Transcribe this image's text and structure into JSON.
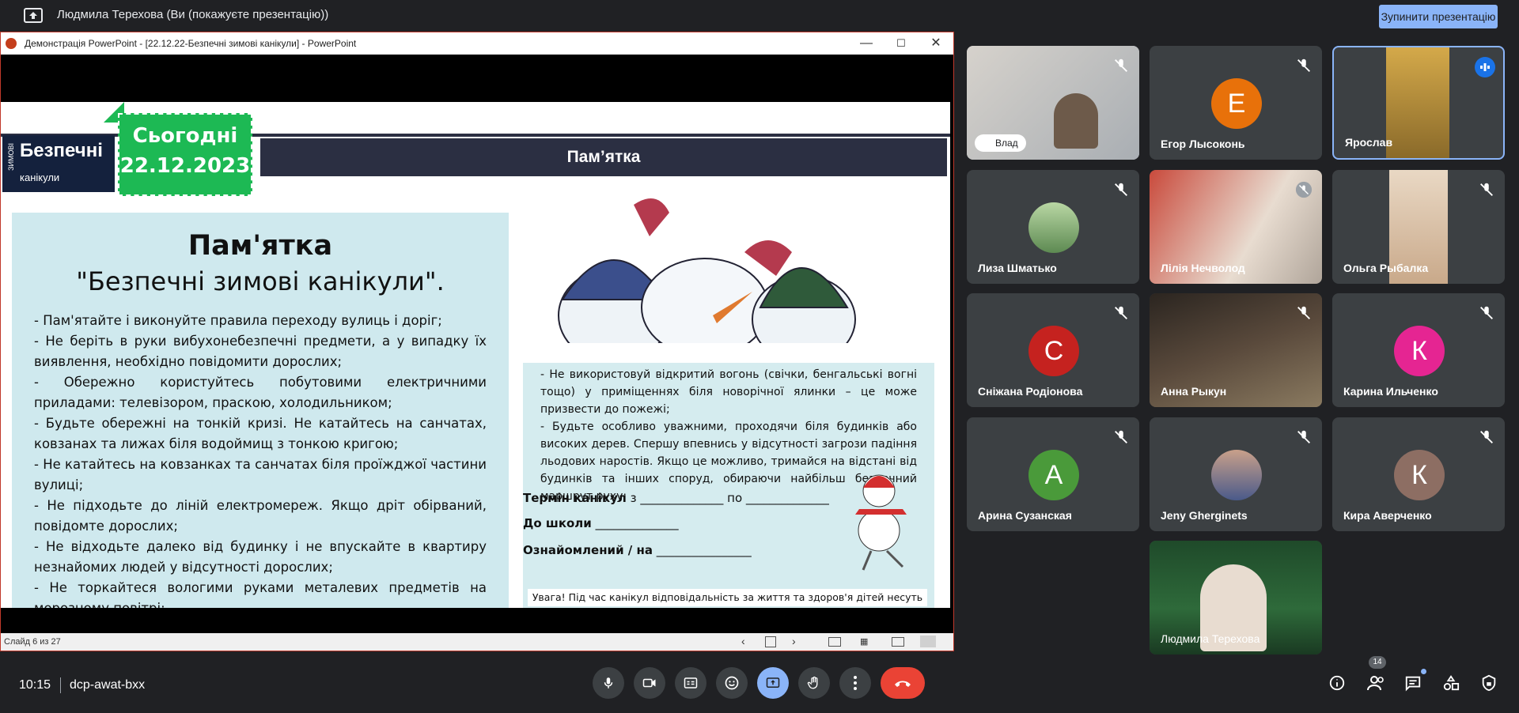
{
  "topbar": {
    "presenter_text": "Людмила Терехова (Ви (покажуєте презентацію))",
    "stop_button": "Зупинити презентацію"
  },
  "ppt": {
    "window_title": "Демонстрація PowerPoint - [22.12.22-Безпечні зимові канікули] - PowerPoint",
    "status_slide": "Слайд 6 из 27"
  },
  "slide": {
    "logo_small": "ЗИМОВІ",
    "logo_big": "Безпечні",
    "logo_sub": "канікули",
    "date_line1": "Сьогодні",
    "date_line2": "22.12.2023",
    "header": "Пам’ятка",
    "left_title": "Пам'ятка",
    "left_subtitle": "\"Безпечні зимові канікули\".",
    "left_items": [
      "- Пам'ятайте і виконуйте правила переходу вулиць і доріг;",
      "- Не беріть в руки вибухонебезпечні предмети, а у випадку їх виявлення, необхідно повідомити дорослих;",
      "- Обережно користуйтесь побутовими електричними приладами: телевізором, праскою, холодильником;",
      "- Будьте обережні на тонкій кризі. Не катайтесь на санчатах, ковзанах та лижах біля водоймищ з тонкою кригою;",
      "- Не катайтесь на ковзанках та санчатах біля проїжджої частини вулиці;",
      "- Не підходьте до ліній електромереж. Якщо дріт обірваний, повідомте дорослих;",
      "- Не відходьте далеко від будинку і не впускайте в квартиру незнайомих людей у відсутності дорослих;",
      "- Не торкайтеся вологими руками металевих предметів на морозному повітрі;"
    ],
    "right_items": [
      "- Не використовуй відкритий вогонь (свічки, бенгальські вогні тощо) у приміщеннях біля новорічної ялинки – це може призвести до пожежі;",
      "- Будьте особливо уважними, проходячи біля будинків або високих дерев. Спершу впевнись у відсутності загрози падіння льодових наростів. Якщо це можливо, тримайся на відстані від будинків та інших споруд, обираючи найбільш безпечний маршрут руху;"
    ],
    "form_term_label": "Термін канікул",
    "form_term_from": " з ______________ по ______________",
    "form_school_label": "До школи",
    "form_school_blank": " ______________",
    "form_ack_label": "Ознайомлений / на",
    "form_ack_blank": " ________________",
    "warning": "Увага! Під час канікул відповідальність за життя та здоров'я дітей несуть батьки!"
  },
  "participants": [
    {
      "name": "",
      "badge": "Влад",
      "type": "video",
      "mic": "muted"
    },
    {
      "name": "Егор Лысоконь",
      "initial": "Е",
      "color": "#e8710a",
      "type": "avatar",
      "mic": "muted"
    },
    {
      "name": "Ярослав",
      "type": "video",
      "mic": "speaking"
    },
    {
      "name": "Лиза Шматько",
      "type": "photo",
      "mic": "muted"
    },
    {
      "name": "Лілія Нечволод",
      "type": "video",
      "mic": "muted"
    },
    {
      "name": "Ольга Рыбалка",
      "type": "video",
      "mic": "muted"
    },
    {
      "name": "Сніжана Родіонова",
      "initial": "С",
      "color": "#c5221f",
      "type": "avatar",
      "mic": "muted"
    },
    {
      "name": "Анна Рыкун",
      "type": "video",
      "mic": "muted"
    },
    {
      "name": "Карина Ильченко",
      "initial": "К",
      "color": "#e52592",
      "type": "avatar",
      "mic": "muted"
    },
    {
      "name": "Арина Сузанская",
      "initial": "А",
      "color": "#4a9a3a",
      "type": "avatar",
      "mic": "muted"
    },
    {
      "name": "Jeny Gherginets",
      "type": "photo",
      "mic": "muted"
    },
    {
      "name": "Кира Аверченко",
      "initial": "К",
      "color": "#8d6e63",
      "type": "avatar",
      "mic": "muted"
    },
    {
      "name": "Людмила Терехова",
      "type": "video",
      "mic": "on"
    }
  ],
  "bottombar": {
    "time": "10:15",
    "meeting_code": "dcp-awat-bxx",
    "people_count": "14"
  }
}
